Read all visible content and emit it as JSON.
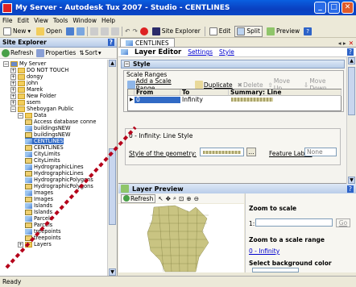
{
  "window": {
    "title": "My Server - Autodesk Tux 2007 - Studio - CENTLINES"
  },
  "menu": [
    "File",
    "Edit",
    "View",
    "Tools",
    "Window",
    "Help"
  ],
  "toolbar": {
    "new": "New",
    "open": "Open",
    "site_explorer": "Site Explorer",
    "edit": "Edit",
    "split": "Split",
    "preview": "Preview"
  },
  "site_explorer": {
    "title": "Site Explorer",
    "refresh": "Refresh",
    "properties": "Properties",
    "sort": "Sort",
    "tree": [
      {
        "label": "My Server",
        "kind": "server"
      },
      {
        "label": "DO NOT TOUCH",
        "kind": "folder"
      },
      {
        "label": "dongy",
        "kind": "folder"
      },
      {
        "label": "john",
        "kind": "folder"
      },
      {
        "label": "Marek",
        "kind": "folder"
      },
      {
        "label": "New Folder",
        "kind": "folder"
      },
      {
        "label": "ssem",
        "kind": "folder"
      },
      {
        "label": "Sheboygan Public",
        "kind": "folder"
      },
      {
        "label": "Data",
        "kind": "folder"
      },
      {
        "label": "Access database conne",
        "kind": "data"
      },
      {
        "label": "buildingsNEW",
        "kind": "layer"
      },
      {
        "label": "buildingsNEW",
        "kind": "data"
      },
      {
        "label": "CENTLINES",
        "kind": "layer"
      },
      {
        "label": "CENTLINES",
        "kind": "data"
      },
      {
        "label": "CityLimits",
        "kind": "layer"
      },
      {
        "label": "CityLimits",
        "kind": "data"
      },
      {
        "label": "HydrographicLines",
        "kind": "layer"
      },
      {
        "label": "HydrographicLines",
        "kind": "data"
      },
      {
        "label": "HydrographicPolygons",
        "kind": "layer"
      },
      {
        "label": "HydrographicPolygons",
        "kind": "data"
      },
      {
        "label": "Images",
        "kind": "layer"
      },
      {
        "label": "Images",
        "kind": "data"
      },
      {
        "label": "Islands",
        "kind": "layer"
      },
      {
        "label": "Islands",
        "kind": "data"
      },
      {
        "label": "Parcels",
        "kind": "layer"
      },
      {
        "label": "Parcels",
        "kind": "data"
      },
      {
        "label": "treepoints",
        "kind": "layer"
      },
      {
        "label": "treepoints",
        "kind": "data"
      },
      {
        "label": "Layers",
        "kind": "folder"
      }
    ]
  },
  "doc_tab": "CENTLINES",
  "layer_editor": {
    "title": "Layer Editor",
    "settings_link": "Settings",
    "style_link": "Style",
    "style_header": "Style",
    "scale_ranges_label": "Scale Ranges",
    "add_range": "Add a Scale Range",
    "duplicate": "Duplicate",
    "delete": "Delete",
    "move_up": "Move Up",
    "move_down": "Move Down",
    "grid_headers": [
      "From",
      "To",
      "Summary: Line"
    ],
    "grid_row": {
      "from": "0",
      "to": "Infinity"
    },
    "line_style_title": "0 - Infinity: Line Style",
    "style_of_geometry": "Style of the geometry:",
    "browse": "...",
    "feature_label": "Feature Label:",
    "feature_label_value": "None"
  },
  "layer_preview": {
    "title": "Layer Preview",
    "refresh": "Refresh",
    "zoom_to_scale": "Zoom to scale",
    "scale_prefix": "1:",
    "go": "Go",
    "zoom_to_range": "Zoom to a scale range",
    "range_link": "0 - Infinity",
    "bg_color": "Select background color"
  },
  "status": "Ready",
  "colors": {
    "accent": "#316ac5",
    "title_blue": "#0a4fd0",
    "annotation": "#b5001a"
  }
}
